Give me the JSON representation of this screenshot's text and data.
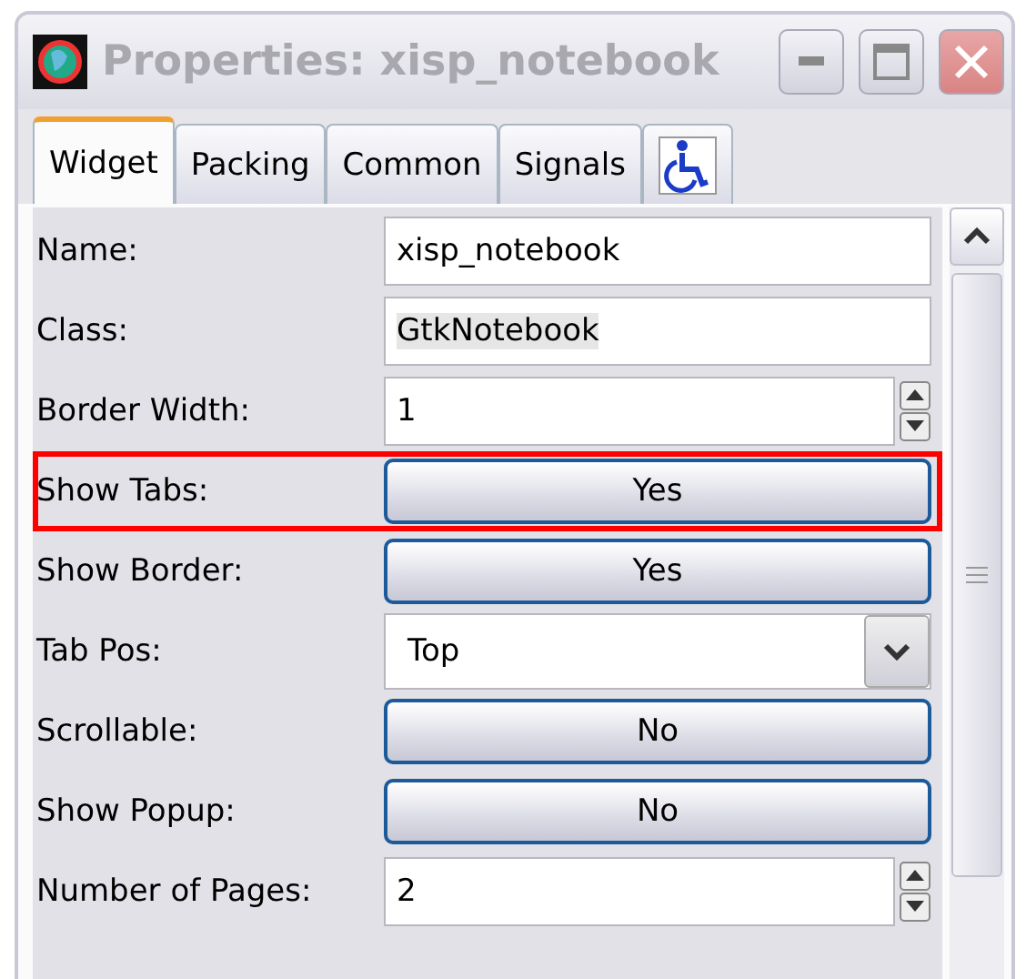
{
  "window": {
    "title": "Properties: xisp_notebook",
    "active": false
  },
  "tabs": [
    {
      "kind": "text",
      "label": "Widget",
      "selected": true
    },
    {
      "kind": "text",
      "label": "Packing",
      "selected": false
    },
    {
      "kind": "text",
      "label": "Common",
      "selected": false
    },
    {
      "kind": "text",
      "label": "Signals",
      "selected": false
    },
    {
      "kind": "accessibility",
      "selected": false
    }
  ],
  "properties": [
    {
      "kind": "entry",
      "label": "Name:",
      "value": "xisp_notebook",
      "highlighted": false
    },
    {
      "kind": "readonly",
      "label": "Class:",
      "value": "GtkNotebook",
      "highlighted": false
    },
    {
      "kind": "spin",
      "label": "Border Width:",
      "value": "1",
      "highlighted": false
    },
    {
      "kind": "toggle",
      "label": "Show Tabs:",
      "value": "Yes",
      "highlighted": true
    },
    {
      "kind": "toggle",
      "label": "Show Border:",
      "value": "Yes",
      "highlighted": false
    },
    {
      "kind": "combo",
      "label": "Tab Pos:",
      "value": "Top",
      "highlighted": false
    },
    {
      "kind": "toggle",
      "label": "Scrollable:",
      "value": "No",
      "highlighted": false
    },
    {
      "kind": "toggle",
      "label": "Show Popup:",
      "value": "No",
      "highlighted": false
    },
    {
      "kind": "spin",
      "label": "Number of Pages:",
      "value": "2",
      "highlighted": false
    }
  ]
}
